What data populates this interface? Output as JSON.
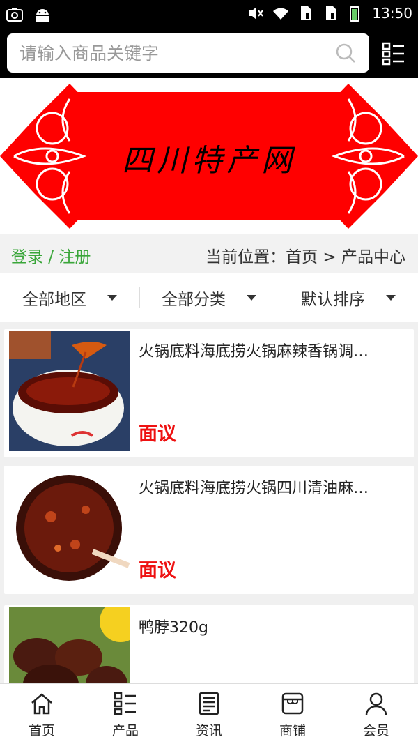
{
  "status_bar": {
    "time": "13:50"
  },
  "search": {
    "placeholder": "请输入商品关键字"
  },
  "banner": {
    "title": "四川特产网"
  },
  "breadcrumb": {
    "login_register": "登录 / 注册",
    "location": "当前位置：首页 > 产品中心"
  },
  "filters": [
    {
      "label": "全部地区"
    },
    {
      "label": "全部分类"
    },
    {
      "label": "默认排序"
    }
  ],
  "products": [
    {
      "title": "火锅底料海底捞火锅麻辣香锅调…",
      "price": "面议"
    },
    {
      "title": "火锅底料海底捞火锅四川清油麻…",
      "price": "面议"
    },
    {
      "title": "鸭脖320g",
      "price": ""
    }
  ],
  "bottom_nav": [
    {
      "label": "首页",
      "icon": "home-icon"
    },
    {
      "label": "产品",
      "icon": "list-icon"
    },
    {
      "label": "资讯",
      "icon": "news-icon"
    },
    {
      "label": "商铺",
      "icon": "shop-icon"
    },
    {
      "label": "会员",
      "icon": "user-icon"
    }
  ],
  "colors": {
    "accent_green": "#3aa63a",
    "price_red": "#e11111",
    "banner_red": "#ff0000"
  }
}
